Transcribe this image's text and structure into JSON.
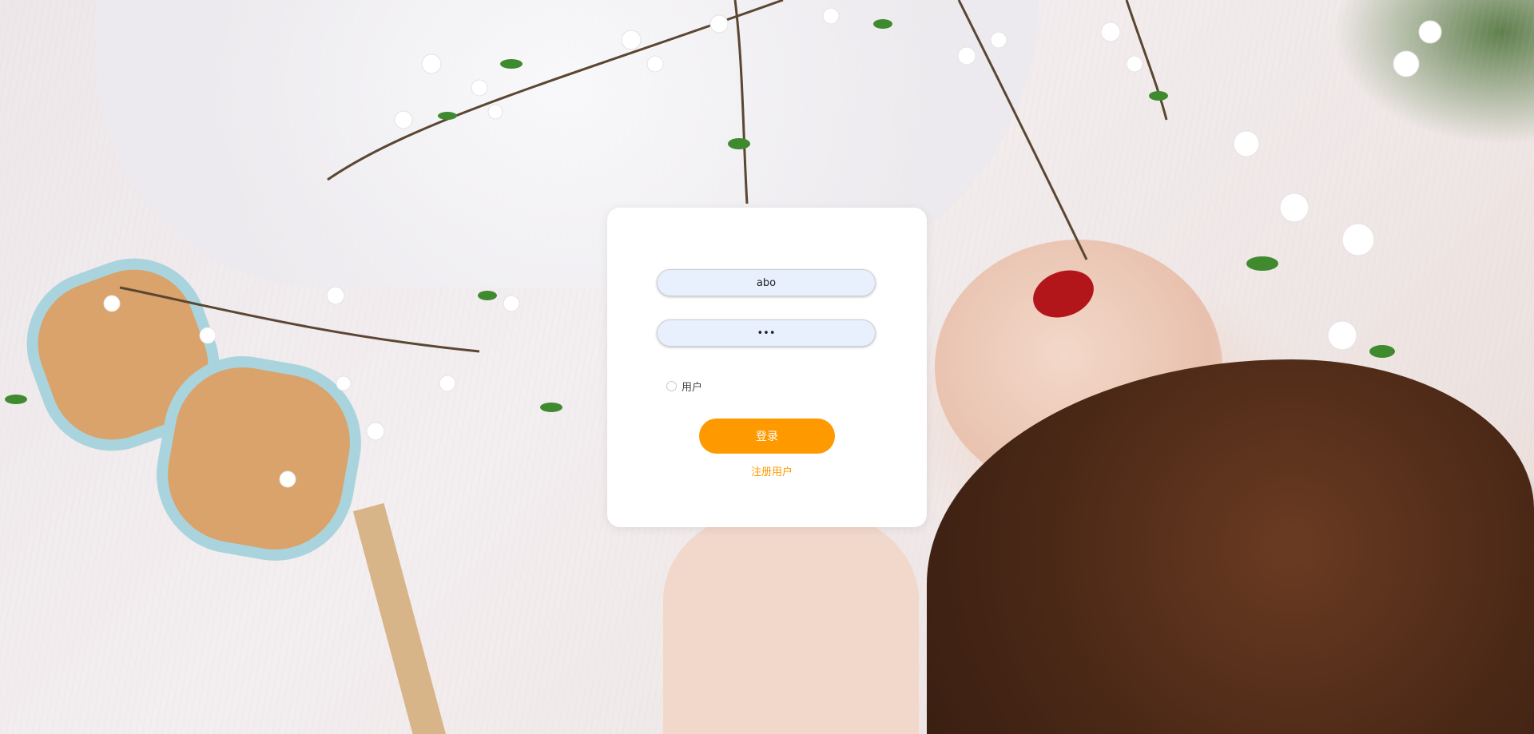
{
  "login": {
    "username_value": "abo",
    "password_value": "•••",
    "role_label": "用户",
    "login_button": "登录",
    "register_link": "注册用户"
  },
  "colors": {
    "accent": "#ff9900",
    "card": "#ffffff",
    "field_bg": "#e8f0fe"
  },
  "background": {
    "description_icon": "photo-background"
  }
}
